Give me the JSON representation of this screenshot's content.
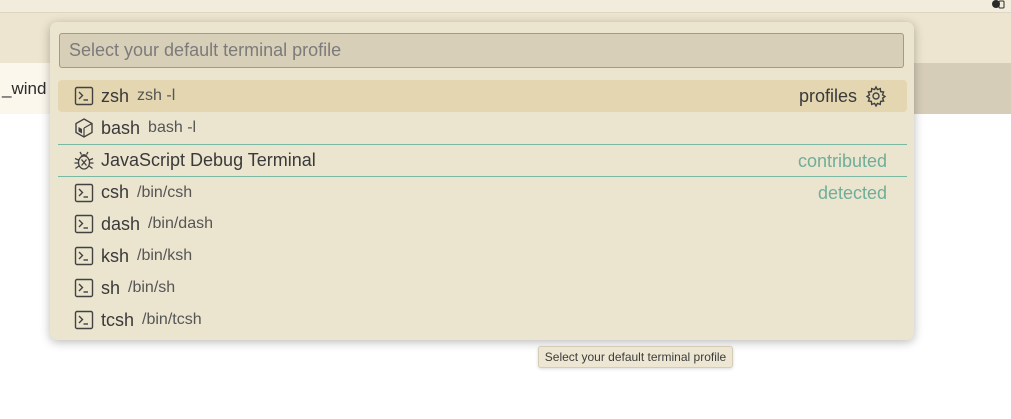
{
  "editor": {
    "tab_label": "_wind"
  },
  "quick_pick": {
    "placeholder": "Select your default terminal profile",
    "value": "",
    "items": [
      {
        "icon": "terminal-icon",
        "label": "zsh",
        "description": "zsh -l",
        "action_label": "profiles",
        "action_icon": "gear-icon",
        "focused": true
      },
      {
        "icon": "bash-icon",
        "label": "bash",
        "description": "bash -l"
      },
      {
        "icon": "debug-icon",
        "label": "JavaScript Debug Terminal",
        "description": "",
        "group": "contributed"
      },
      {
        "icon": "terminal-icon",
        "label": "csh",
        "description": "/bin/csh",
        "group": "detected"
      },
      {
        "icon": "terminal-icon",
        "label": "dash",
        "description": "/bin/dash"
      },
      {
        "icon": "terminal-icon",
        "label": "ksh",
        "description": "/bin/ksh"
      },
      {
        "icon": "terminal-icon",
        "label": "sh",
        "description": "/bin/sh"
      },
      {
        "icon": "terminal-icon",
        "label": "tcsh",
        "description": "/bin/tcsh"
      }
    ]
  },
  "tooltip": {
    "text": "Select your default terminal profile"
  },
  "colors": {
    "accent_group": "#6fae98",
    "focused_row": "#e3d6b0",
    "widget_bg": "#ebe4cf"
  }
}
